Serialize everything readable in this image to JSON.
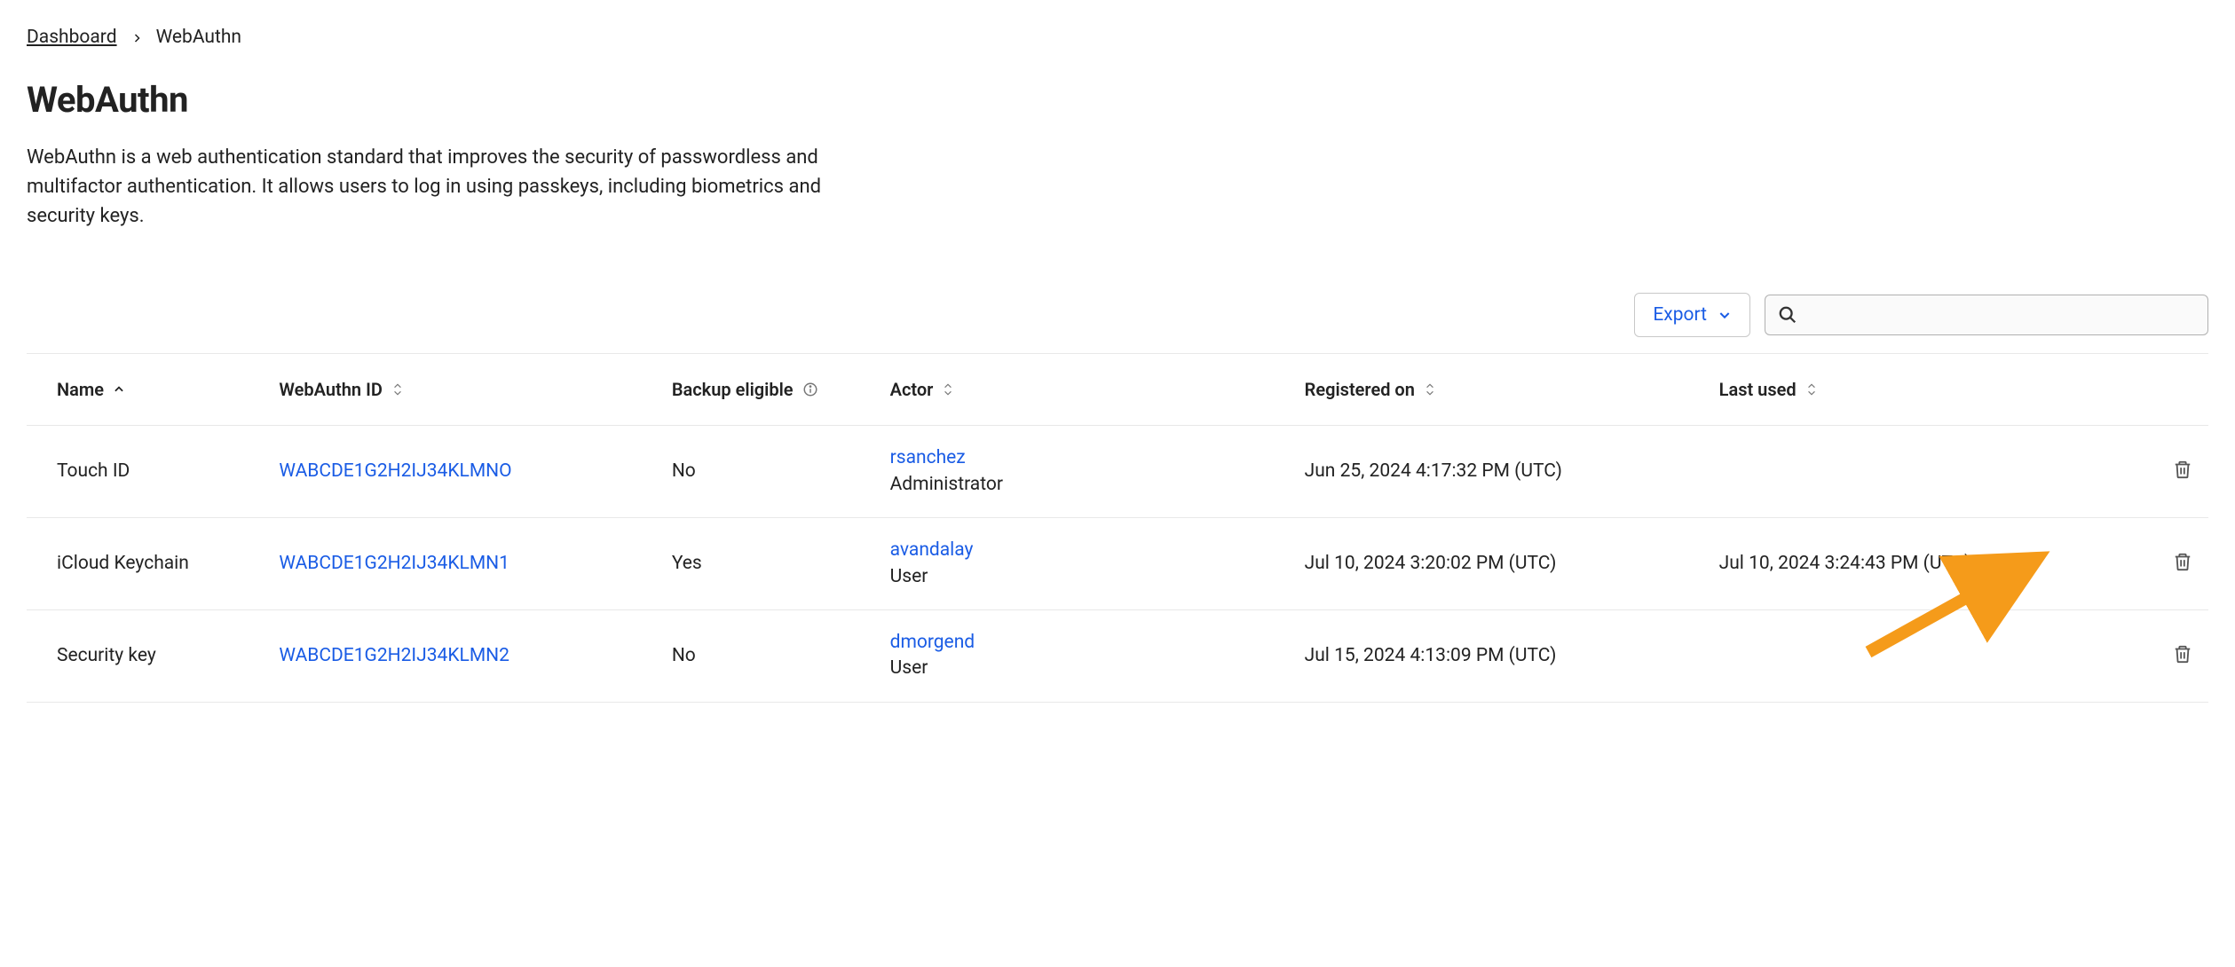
{
  "breadcrumb": {
    "root": "Dashboard",
    "current": "WebAuthn"
  },
  "page": {
    "title": "WebAuthn",
    "description": "WebAuthn is a web authentication standard that improves the security of passwordless and multifactor authentication. It allows users to log in using passkeys, including biometrics and security keys."
  },
  "toolbar": {
    "export_label": "Export",
    "search_placeholder": ""
  },
  "table": {
    "columns": {
      "name": "Name",
      "webauthn_id": "WebAuthn ID",
      "backup_eligible": "Backup eligible",
      "actor": "Actor",
      "registered_on": "Registered on",
      "last_used": "Last used"
    },
    "rows": [
      {
        "name": "Touch ID",
        "webauthn_id": "WABCDE1G2H2IJ34KLMNO",
        "backup_eligible": "No",
        "actor_name": "rsanchez",
        "actor_role": "Administrator",
        "registered_on": "Jun 25, 2024 4:17:32 PM (UTC)",
        "last_used": ""
      },
      {
        "name": "iCloud Keychain",
        "webauthn_id": "WABCDE1G2H2IJ34KLMN1",
        "backup_eligible": "Yes",
        "actor_name": "avandalay",
        "actor_role": "User",
        "registered_on": "Jul 10, 2024 3:20:02 PM (UTC)",
        "last_used": "Jul 10, 2024 3:24:43 PM (UTC)"
      },
      {
        "name": "Security key",
        "webauthn_id": "WABCDE1G2H2IJ34KLMN2",
        "backup_eligible": "No",
        "actor_name": "dmorgend",
        "actor_role": "User",
        "registered_on": "Jul 15, 2024 4:13:09 PM (UTC)",
        "last_used": ""
      }
    ]
  }
}
